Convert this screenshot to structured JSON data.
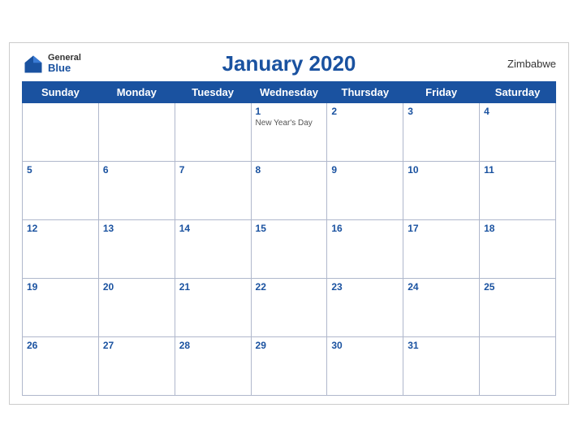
{
  "header": {
    "title": "January 2020",
    "country": "Zimbabwe",
    "logo": {
      "general": "General",
      "blue": "Blue"
    }
  },
  "weekdays": [
    "Sunday",
    "Monday",
    "Tuesday",
    "Wednesday",
    "Thursday",
    "Friday",
    "Saturday"
  ],
  "weeks": [
    [
      {
        "date": "",
        "holiday": ""
      },
      {
        "date": "",
        "holiday": ""
      },
      {
        "date": "",
        "holiday": ""
      },
      {
        "date": "1",
        "holiday": "New Year's Day"
      },
      {
        "date": "2",
        "holiday": ""
      },
      {
        "date": "3",
        "holiday": ""
      },
      {
        "date": "4",
        "holiday": ""
      }
    ],
    [
      {
        "date": "5",
        "holiday": ""
      },
      {
        "date": "6",
        "holiday": ""
      },
      {
        "date": "7",
        "holiday": ""
      },
      {
        "date": "8",
        "holiday": ""
      },
      {
        "date": "9",
        "holiday": ""
      },
      {
        "date": "10",
        "holiday": ""
      },
      {
        "date": "11",
        "holiday": ""
      }
    ],
    [
      {
        "date": "12",
        "holiday": ""
      },
      {
        "date": "13",
        "holiday": ""
      },
      {
        "date": "14",
        "holiday": ""
      },
      {
        "date": "15",
        "holiday": ""
      },
      {
        "date": "16",
        "holiday": ""
      },
      {
        "date": "17",
        "holiday": ""
      },
      {
        "date": "18",
        "holiday": ""
      }
    ],
    [
      {
        "date": "19",
        "holiday": ""
      },
      {
        "date": "20",
        "holiday": ""
      },
      {
        "date": "21",
        "holiday": ""
      },
      {
        "date": "22",
        "holiday": ""
      },
      {
        "date": "23",
        "holiday": ""
      },
      {
        "date": "24",
        "holiday": ""
      },
      {
        "date": "25",
        "holiday": ""
      }
    ],
    [
      {
        "date": "26",
        "holiday": ""
      },
      {
        "date": "27",
        "holiday": ""
      },
      {
        "date": "28",
        "holiday": ""
      },
      {
        "date": "29",
        "holiday": ""
      },
      {
        "date": "30",
        "holiday": ""
      },
      {
        "date": "31",
        "holiday": ""
      },
      {
        "date": "",
        "holiday": ""
      }
    ]
  ]
}
